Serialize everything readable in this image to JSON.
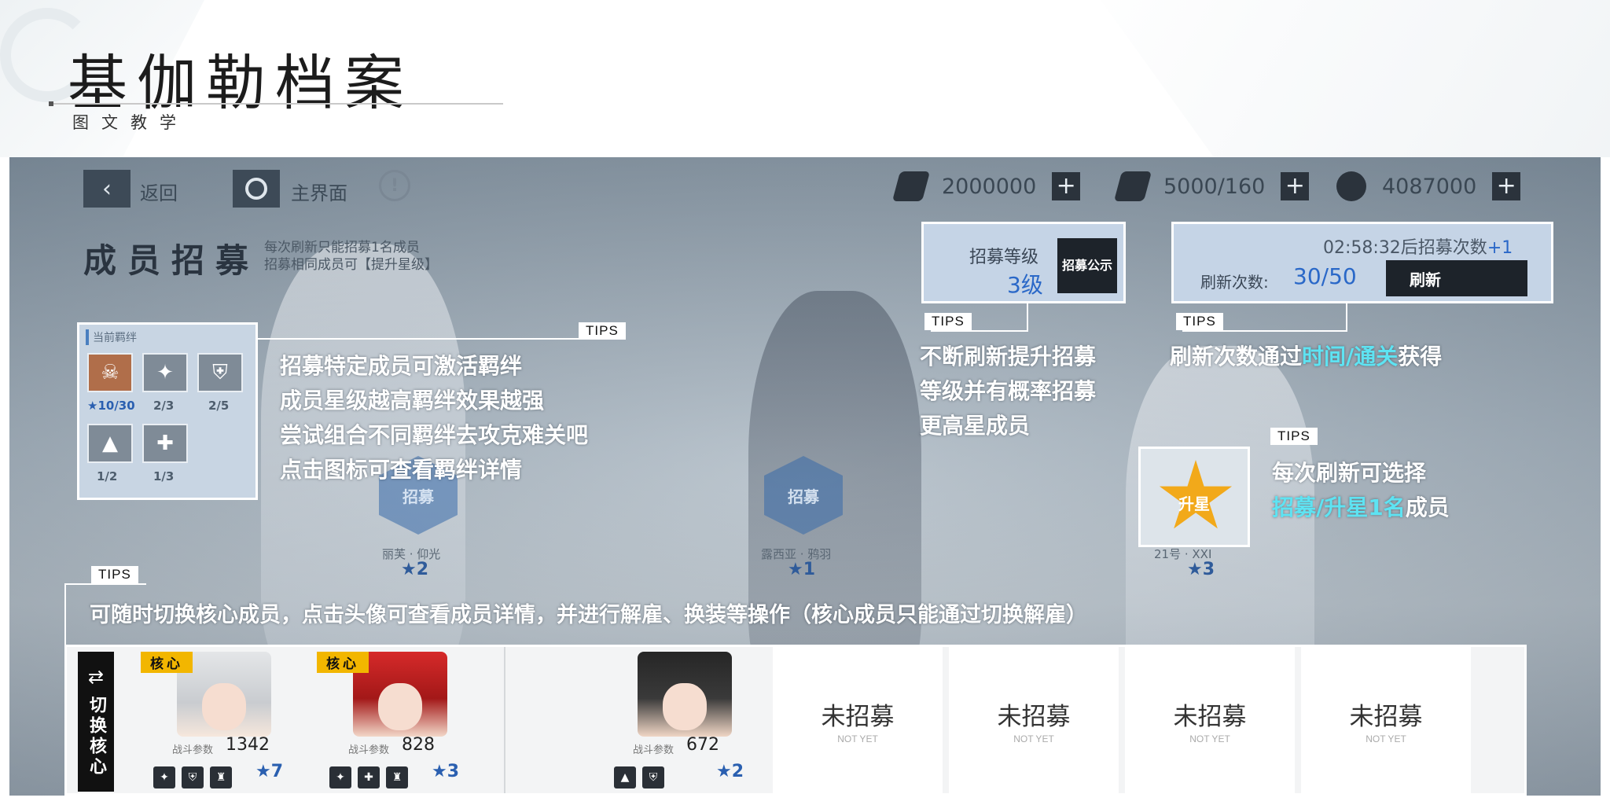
{
  "header": {
    "title": "基伽勒档案",
    "subtitle": "图文教学"
  },
  "topbar": {
    "back_label": "返回",
    "home_label": "主界面",
    "resources": [
      {
        "icon": "ticket-icon",
        "value": "2000000"
      },
      {
        "icon": "bullet-icon",
        "value": "5000/160"
      },
      {
        "icon": "coin-icon",
        "value": "4087000"
      }
    ]
  },
  "recruit": {
    "title": "成员招募",
    "desc_lines": [
      "每次刷新只能招募1名成员",
      "招募相同成员可【提升星级】"
    ],
    "hex_label": "招募",
    "candidates": [
      {
        "name": "丽芙 · 仰光",
        "stars": "★2"
      },
      {
        "name": "露西亚 · 鸦羽",
        "stars": "★1"
      },
      {
        "name": "21号 · XXI",
        "stars": "★3"
      }
    ]
  },
  "bond": {
    "header": "当前羁绊",
    "counts": [
      "★10/30",
      "2/3",
      "2/5",
      "1/2",
      "1/3"
    ]
  },
  "tips_label": "TIPS",
  "tip_bond": [
    "招募特定成员可激活羁绊",
    "成员星级越高羁绊效果越强",
    "尝试组合不同羁绊去攻克难关吧",
    "点击图标可查看羁绊详情"
  ],
  "level_panel": {
    "label": "招募等级",
    "value": "3级",
    "button": "招募公示"
  },
  "tip_level": [
    "不断刷新提升招募",
    "等级并有概率招募",
    "更高星成员"
  ],
  "refresh_panel": {
    "timer_text": "02:58:32后招募次数",
    "timer_plus": "+1",
    "count_label": "刷新次数:",
    "count_value": "30/50",
    "button": "刷新"
  },
  "tip_refresh": {
    "pre": "刷新次数通过",
    "hl": "时间/通关",
    "post": "获得"
  },
  "star_box": {
    "label": "升星"
  },
  "tip_star": {
    "line1": "每次刷新可选择",
    "hl": "招募/升星1名",
    "post": "成员"
  },
  "tip_bottom": "可随时切换核心成员，点击头像可查看成员详情，并进行解雇、换装等操作（核心成员只能通过切换解雇）",
  "switch": {
    "label": "切换核心"
  },
  "members": [
    {
      "core": "核心",
      "cp_label": "战斗参数",
      "cp": "1342",
      "stars": "★7"
    },
    {
      "core": "核心",
      "cp_label": "战斗参数",
      "cp": "828",
      "stars": "★3"
    },
    {
      "core": "",
      "cp_label": "战斗参数",
      "cp": "672",
      "stars": "★2"
    }
  ],
  "empty_slot": {
    "label": "未招募",
    "sub": "NOT YET"
  }
}
